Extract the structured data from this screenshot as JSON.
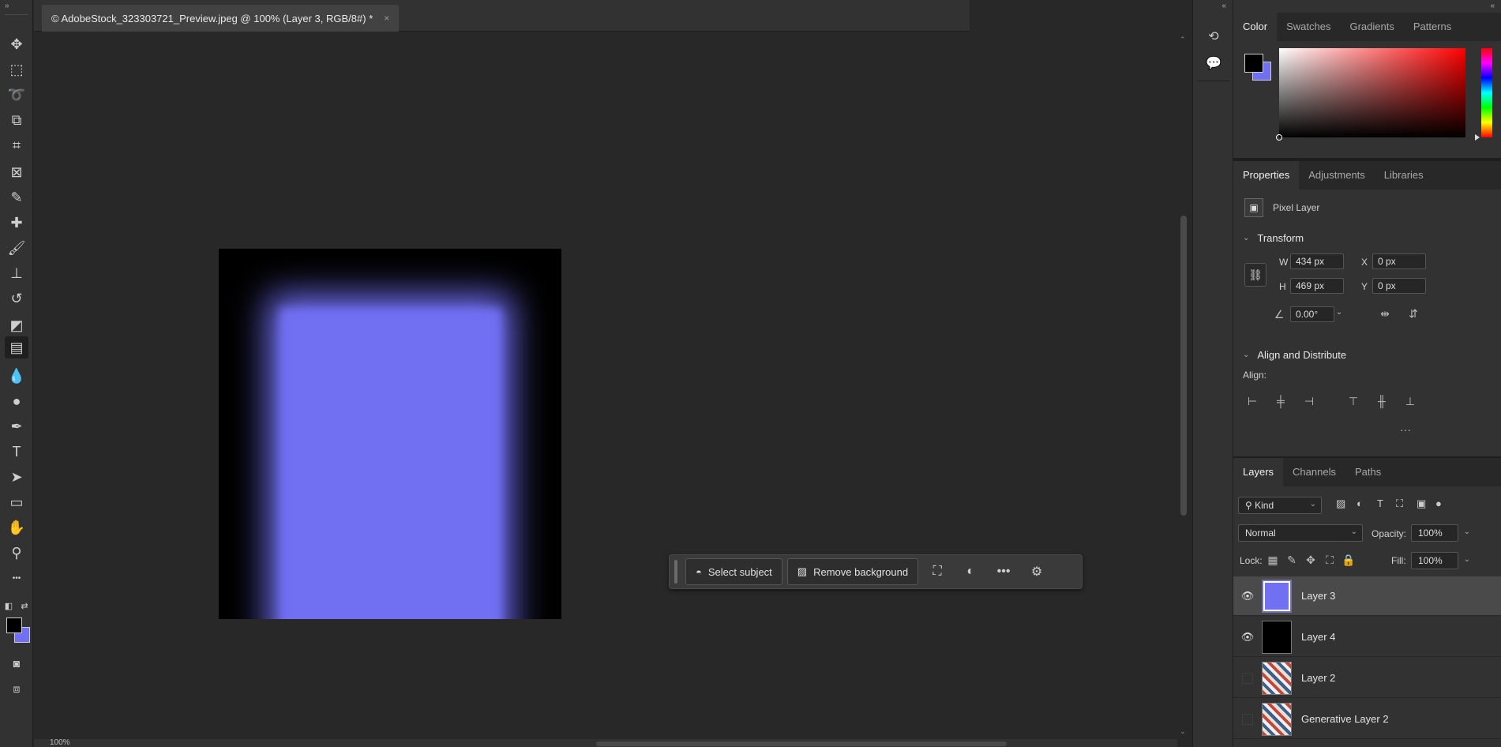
{
  "document": {
    "tab_title": "© AdobeStock_323303721_Preview.jpeg @ 100% (Layer 3, RGB/8#) *",
    "close_glyph": "×"
  },
  "toolbar": {
    "collapse_glyph": "»",
    "tools": [
      {
        "name": "move-icon",
        "glyph": "✥"
      },
      {
        "name": "marquee-icon",
        "glyph": "⬚"
      },
      {
        "name": "lasso-icon",
        "glyph": "➰"
      },
      {
        "name": "object-select-icon",
        "glyph": "⧉"
      },
      {
        "name": "crop-icon",
        "glyph": "⌗"
      },
      {
        "name": "frame-icon",
        "glyph": "⊠"
      },
      {
        "name": "eyedropper-icon",
        "glyph": "✎"
      },
      {
        "name": "healing-brush-icon",
        "glyph": "✚"
      },
      {
        "name": "brush-icon",
        "glyph": "🖌"
      },
      {
        "name": "stamp-icon",
        "glyph": "⊥"
      },
      {
        "name": "history-brush-icon",
        "glyph": "↺"
      },
      {
        "name": "eraser-icon",
        "glyph": "◩"
      },
      {
        "name": "gradient-icon",
        "glyph": "▤"
      },
      {
        "name": "blur-icon",
        "glyph": "💧"
      },
      {
        "name": "dodge-icon",
        "glyph": "●"
      },
      {
        "name": "pen-icon",
        "glyph": "✒"
      },
      {
        "name": "type-icon",
        "glyph": "T"
      },
      {
        "name": "path-select-icon",
        "glyph": "➤"
      },
      {
        "name": "rectangle-icon",
        "glyph": "▭"
      },
      {
        "name": "hand-icon",
        "glyph": "✋"
      },
      {
        "name": "zoom-icon",
        "glyph": "⚲"
      },
      {
        "name": "more-tools-icon",
        "glyph": "•••"
      }
    ],
    "bottom_tools": [
      {
        "name": "quick-mask-icon",
        "glyph": "◙"
      },
      {
        "name": "screen-mode-icon",
        "glyph": "⧈"
      }
    ],
    "swap_glyph": "⇄",
    "default_colors_glyph": "◧"
  },
  "context_bar": {
    "select_subject": "Select subject",
    "remove_background": "Remove background",
    "select_subject_icon": "◓",
    "remove_bg_icon": "▨",
    "transform_icon": "⛶",
    "adjust_icon": "◐",
    "more_icon": "•••",
    "settings_icon": "⚙"
  },
  "status": {
    "zoom": "100%"
  },
  "dock": {
    "collapse_glyph": "«",
    "history_icon": "⟲",
    "comments_icon": "💬"
  },
  "panels": {
    "collapse_glyph": "«",
    "color_tabs": [
      "Color",
      "Swatches",
      "Gradients",
      "Patterns"
    ],
    "properties_tabs": [
      "Properties",
      "Adjustments",
      "Libraries"
    ],
    "layers_tabs": [
      "Layers",
      "Channels",
      "Paths"
    ]
  },
  "properties": {
    "layer_type": "Pixel Layer",
    "transform_heading": "Transform",
    "w_label": "W",
    "w_value": "434 px",
    "h_label": "H",
    "h_value": "469 px",
    "x_label": "X",
    "x_value": "0 px",
    "y_label": "Y",
    "y_value": "0 px",
    "angle_value": "0.00°",
    "align_heading": "Align and Distribute",
    "align_label": "Align:",
    "more_glyph": "···"
  },
  "layers": {
    "kind_label": "Kind",
    "blend_mode": "Normal",
    "opacity_label": "Opacity:",
    "opacity_value": "100%",
    "lock_label": "Lock:",
    "fill_label": "Fill:",
    "fill_value": "100%",
    "rows": [
      {
        "name": "Layer 3",
        "visible": true,
        "selected": true,
        "thumb": "blue"
      },
      {
        "name": "Layer 4",
        "visible": true,
        "selected": false,
        "thumb": "black"
      },
      {
        "name": "Layer 2",
        "visible": false,
        "selected": false,
        "thumb": "photo"
      },
      {
        "name": "Generative Layer 2",
        "visible": false,
        "selected": false,
        "thumb": "photo"
      }
    ]
  },
  "colors": {
    "foreground": "#000000",
    "background": "#716ff2",
    "accent": "#716ff2"
  }
}
